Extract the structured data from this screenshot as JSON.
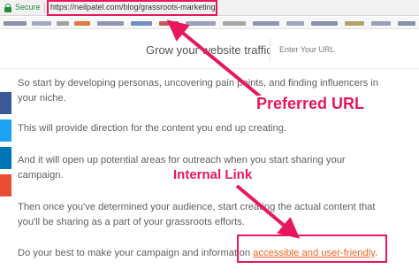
{
  "browser": {
    "secure_label": "Secure",
    "url": "https://neilpatel.com/blog/grassroots-marketing/"
  },
  "header": {
    "tagline": "Grow your website traffic",
    "url_input_placeholder": "Enter Your URL"
  },
  "article": {
    "paragraphs": [
      {
        "line1": "So start by developing personas, uncovering pain points, and finding influencers in",
        "line2": "your niche."
      },
      {
        "line1": "This will provide direction for the content you end up creating."
      },
      {
        "line1": "And it will open up potential areas for outreach when you start sharing your",
        "line2": "campaign."
      },
      {
        "line1": "Then once you've determined your audience, start creating the actual content that",
        "line2": "you'll be sharing as a part of your grassroots efforts."
      },
      {
        "line1_prefix": "Do your best to make your campaign and information ",
        "link_text": "accessible and user-friendly",
        "line1_suffix": "."
      }
    ]
  },
  "annotations": {
    "preferred_url": "Preferred URL",
    "internal_link": "Internal Link"
  },
  "colors": {
    "annotation": "#e8175d",
    "link": "#f26522",
    "secure": "#1e8e3e",
    "share_buttons": [
      "#3b5998",
      "#1da1f2",
      "#0077b5",
      "#e94e34"
    ]
  }
}
